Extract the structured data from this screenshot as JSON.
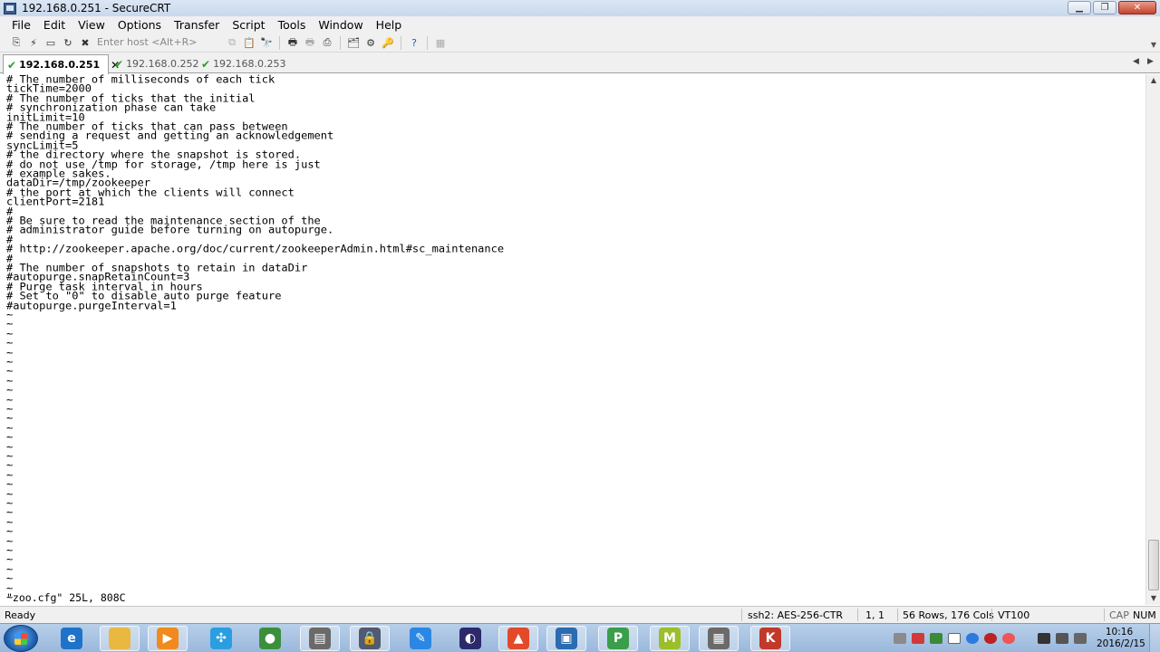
{
  "window": {
    "title": "192.168.0.251 - SecureCRT"
  },
  "menu": [
    "File",
    "Edit",
    "View",
    "Options",
    "Transfer",
    "Script",
    "Tools",
    "Window",
    "Help"
  ],
  "toolbar": {
    "host_placeholder": "Enter host <Alt+R>"
  },
  "tabs": [
    {
      "label": "192.168.0.251",
      "active": true
    },
    {
      "label": "192.168.0.252",
      "active": false
    },
    {
      "label": "192.168.0.253",
      "active": false
    }
  ],
  "terminal": {
    "lines": [
      "# The number of milliseconds of each tick",
      "tickTime=2000",
      "# The number of ticks that the initial",
      "# synchronization phase can take",
      "initLimit=10",
      "# The number of ticks that can pass between",
      "# sending a request and getting an acknowledgement",
      "syncLimit=5",
      "# the directory where the snapshot is stored.",
      "# do not use /tmp for storage, /tmp here is just",
      "# example sakes.",
      "dataDir=/tmp/zookeeper",
      "# the port at which the clients will connect",
      "clientPort=2181",
      "#",
      "# Be sure to read the maintenance section of the",
      "# administrator guide before turning on autopurge.",
      "#",
      "# http://zookeeper.apache.org/doc/current/zookeeperAdmin.html#sc_maintenance",
      "#",
      "# The number of snapshots to retain in dataDir",
      "#autopurge.snapRetainCount=3",
      "# Purge task interval in hours",
      "# Set to \"0\" to disable auto purge feature",
      "#autopurge.purgeInterval=1",
      "~",
      "~",
      "~",
      "~",
      "~",
      "~",
      "~",
      "~",
      "~",
      "~",
      "~",
      "~",
      "~",
      "~",
      "~",
      "~",
      "~",
      "~",
      "~",
      "~",
      "~",
      "~",
      "~",
      "~",
      "~",
      "~",
      "~",
      "~",
      "~",
      "~",
      "~",
      "~",
      "~"
    ],
    "status_line": "\"zoo.cfg\" 25L, 808C"
  },
  "statusbar": {
    "ready": "Ready",
    "cipher": "ssh2: AES-256-CTR",
    "cursor": "1,   1",
    "size": "56 Rows, 176 Cols",
    "emulation": "VT100",
    "caps": "CAP",
    "num": "NUM"
  },
  "taskbar": {
    "clock_time": "10:16",
    "clock_date": "2016/2/15",
    "apps": [
      {
        "name": "ie-icon",
        "color": "#1e73c8",
        "glyph": "e"
      },
      {
        "name": "explorer-icon",
        "color": "#e8b840",
        "glyph": ""
      },
      {
        "name": "media-player-icon",
        "color": "#f08a1e",
        "glyph": "▶"
      },
      {
        "name": "cloud-sync-icon",
        "color": "#2a9ee0",
        "glyph": "✣"
      },
      {
        "name": "chrome-icon",
        "color": "#3b8f3b",
        "glyph": "●"
      },
      {
        "name": "toolbox-icon",
        "color": "#6a6a6a",
        "glyph": "▤"
      },
      {
        "name": "lock-app-icon",
        "color": "#505a70",
        "glyph": "🔒"
      },
      {
        "name": "feather-app-icon",
        "color": "#2b87e3",
        "glyph": "✎"
      },
      {
        "name": "eclipse-icon",
        "color": "#2c2a6a",
        "glyph": "◐"
      },
      {
        "name": "fire-app-icon",
        "color": "#e24a2a",
        "glyph": "▲"
      },
      {
        "name": "virtualbox-icon",
        "color": "#2b6bb0",
        "glyph": "▣"
      },
      {
        "name": "pycharm-icon",
        "color": "#3a9e4a",
        "glyph": "P"
      },
      {
        "name": "m-app-icon",
        "color": "#9bbf2a",
        "glyph": "M"
      },
      {
        "name": "securecrt-task-icon",
        "color": "#6a6a6a",
        "glyph": "▦"
      },
      {
        "name": "pdf-app-icon",
        "color": "#c0392b",
        "glyph": "K"
      }
    ]
  }
}
